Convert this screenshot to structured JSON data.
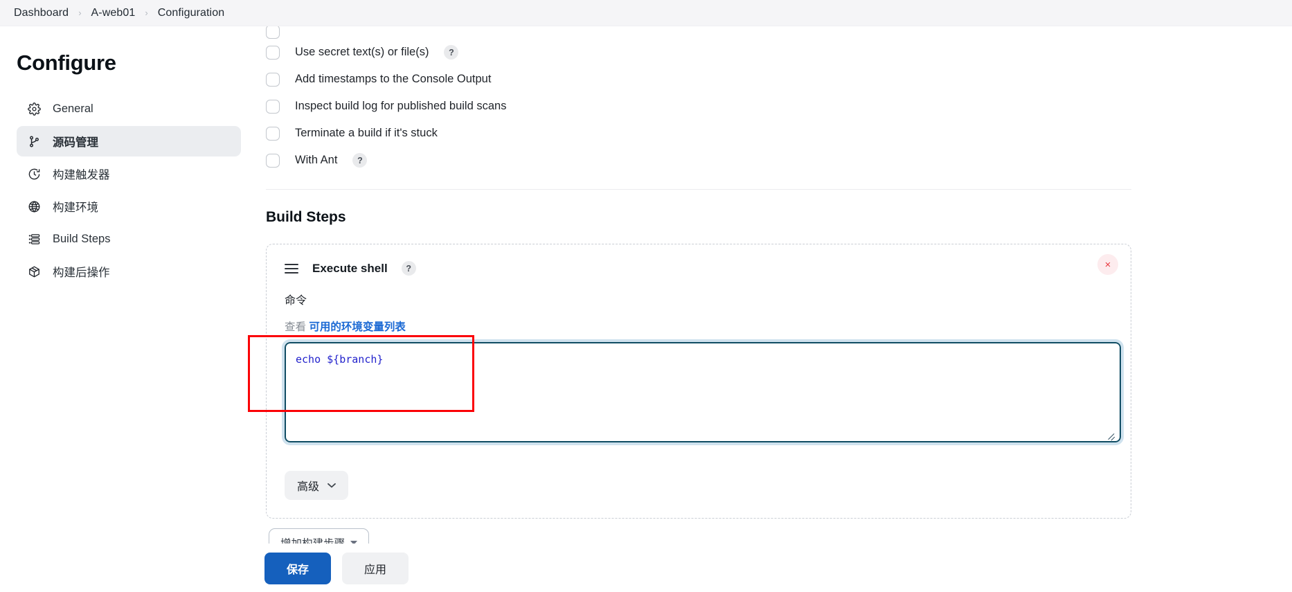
{
  "breadcrumb": {
    "items": [
      "Dashboard",
      "A-web01",
      "Configuration"
    ],
    "separator": "›"
  },
  "sidebar": {
    "title": "Configure",
    "items": [
      {
        "label": "General",
        "icon": "gear-icon",
        "active": false
      },
      {
        "label": "源码管理",
        "icon": "source-branch-icon",
        "active": true
      },
      {
        "label": "构建触发器",
        "icon": "clock-icon",
        "active": false
      },
      {
        "label": "构建环境",
        "icon": "globe-icon",
        "active": false
      },
      {
        "label": "Build Steps",
        "icon": "list-icon",
        "active": false
      },
      {
        "label": "构建后操作",
        "icon": "package-icon",
        "active": false
      }
    ]
  },
  "build_environment": {
    "checkboxes": [
      {
        "label": "Use secret text(s) or file(s)",
        "checked": false,
        "help": "?"
      },
      {
        "label": "Add timestamps to the Console Output",
        "checked": false,
        "help": ""
      },
      {
        "label": "Inspect build log for published build scans",
        "checked": false,
        "help": ""
      },
      {
        "label": "Terminate a build if it's stuck",
        "checked": false,
        "help": ""
      },
      {
        "label": "With Ant",
        "checked": false,
        "help": "?"
      }
    ]
  },
  "build_steps": {
    "section_title": "Build Steps",
    "step": {
      "name": "Execute shell",
      "help": "?",
      "close_icon": "×",
      "command_label": "命令",
      "env_prefix": "查看",
      "env_link": "可用的环境变量列表",
      "command_value": "echo ${branch}",
      "advanced_label": "高级",
      "advanced_chevron": "⌄"
    },
    "add_step_label": "增加构建步骤"
  },
  "actions": {
    "save_label": "保存",
    "apply_label": "应用"
  },
  "colors": {
    "accent_blue": "#1560bd",
    "link_blue": "#1b69d4",
    "annotation_red": "#fb0006",
    "close_red": "#e8383f",
    "code_blue": "#2222cc",
    "sidebar_active_bg": "#ebedf0"
  }
}
